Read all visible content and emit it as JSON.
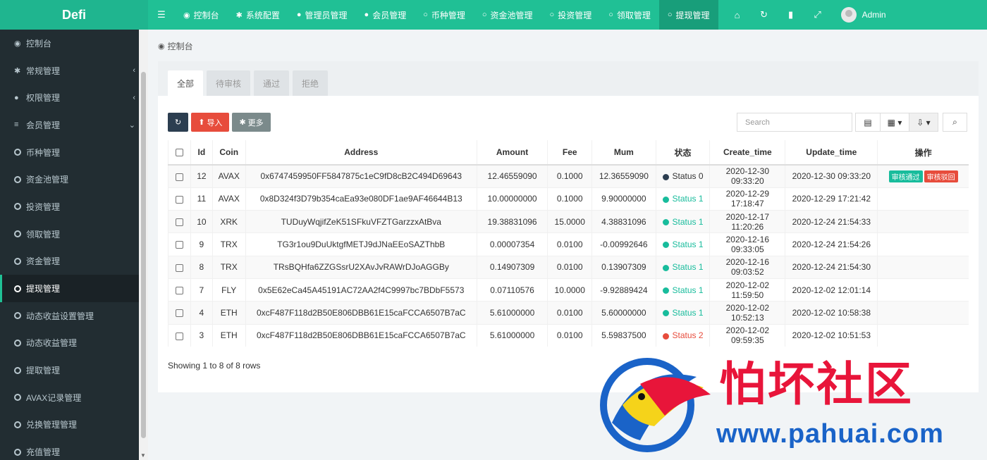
{
  "app": {
    "logo": "Defi"
  },
  "topnav": {
    "items": [
      {
        "label": "控制台",
        "icon": "dashboard-icon",
        "glyph": "◉"
      },
      {
        "label": "系统配置",
        "icon": "gear-icon",
        "glyph": "✱"
      },
      {
        "label": "管理员管理",
        "icon": "user-icon",
        "glyph": "●"
      },
      {
        "label": "会员管理",
        "icon": "user-icon",
        "glyph": "●"
      },
      {
        "label": "币种管理",
        "icon": "circle-icon",
        "glyph": "○"
      },
      {
        "label": "资金池管理",
        "icon": "circle-icon",
        "glyph": "○"
      },
      {
        "label": "投资管理",
        "icon": "circle-icon",
        "glyph": "○"
      },
      {
        "label": "领取管理",
        "icon": "circle-icon",
        "glyph": "○"
      },
      {
        "label": "提现管理",
        "icon": "circle-icon",
        "glyph": "○",
        "active": true
      }
    ],
    "user": "Admin"
  },
  "sidebar": {
    "items": [
      {
        "label": "控制台",
        "icon": "dashboard-icon",
        "glyph": "◉"
      },
      {
        "label": "常规管理",
        "icon": "cogs-icon",
        "glyph": "✱",
        "arrow": "‹"
      },
      {
        "label": "权限管理",
        "icon": "group-icon",
        "glyph": "●",
        "arrow": "‹"
      },
      {
        "label": "会员管理",
        "icon": "list-icon",
        "glyph": "≡",
        "arrow": "⌄"
      },
      {
        "label": "币种管理",
        "circle": true
      },
      {
        "label": "资金池管理",
        "circle": true
      },
      {
        "label": "投资管理",
        "circle": true
      },
      {
        "label": "领取管理",
        "circle": true
      },
      {
        "label": "资金管理",
        "circle": true
      },
      {
        "label": "提现管理",
        "circle": true,
        "active": true
      },
      {
        "label": "动态收益设置管理",
        "circle": true
      },
      {
        "label": "动态收益管理",
        "circle": true
      },
      {
        "label": "提取管理",
        "circle": true
      },
      {
        "label": "AVAX记录管理",
        "circle": true
      },
      {
        "label": "兑换管理管理",
        "circle": true
      },
      {
        "label": "充值管理",
        "circle": true
      }
    ]
  },
  "breadcrumb": {
    "label": "控制台"
  },
  "tabs": [
    "全部",
    "待审核",
    "通过",
    "拒绝"
  ],
  "toolbar": {
    "import_label": "导入",
    "more_label": "更多"
  },
  "search": {
    "placeholder": "Search"
  },
  "table": {
    "headers": [
      "Id",
      "Coin",
      "Address",
      "Amount",
      "Fee",
      "Mum",
      "状态",
      "Create_time",
      "Update_time",
      "操作"
    ],
    "rows": [
      {
        "id": "12",
        "coin": "AVAX",
        "address": "0x6747459950FF5847875c1eC9fD8cB2C494D69643",
        "amount": "12.46559090",
        "fee": "0.1000",
        "mum": "12.36559090",
        "status": "Status 0",
        "status_color": "#2c3e50",
        "create": "2020-12-30 09:33:20",
        "update": "2020-12-30 09:33:20",
        "actions": [
          "审核通过",
          "审核驳回"
        ]
      },
      {
        "id": "11",
        "coin": "AVAX",
        "address": "0x8D324f3D79b354caEa93e080DF1ae9AF46644B13",
        "amount": "10.00000000",
        "fee": "0.1000",
        "mum": "9.90000000",
        "status": "Status 1",
        "status_color": "#18bc9c",
        "create": "2020-12-29 17:18:47",
        "update": "2020-12-29 17:21:42",
        "actions": []
      },
      {
        "id": "10",
        "coin": "XRK",
        "address": "TUDuyWqjifZeK51SFkuVFZTGarzzxAtBva",
        "amount": "19.38831096",
        "fee": "15.0000",
        "mum": "4.38831096",
        "status": "Status 1",
        "status_color": "#18bc9c",
        "create": "2020-12-17 11:20:26",
        "update": "2020-12-24 21:54:33",
        "actions": []
      },
      {
        "id": "9",
        "coin": "TRX",
        "address": "TG3r1ou9DuUktgfMETJ9dJNaEEoSAZThbB",
        "amount": "0.00007354",
        "fee": "0.0100",
        "mum": "-0.00992646",
        "status": "Status 1",
        "status_color": "#18bc9c",
        "create": "2020-12-16 09:33:05",
        "update": "2020-12-24 21:54:26",
        "actions": []
      },
      {
        "id": "8",
        "coin": "TRX",
        "address": "TRsBQHfa6ZZGSsrU2XAvJvRAWrDJoAGGBy",
        "amount": "0.14907309",
        "fee": "0.0100",
        "mum": "0.13907309",
        "status": "Status 1",
        "status_color": "#18bc9c",
        "create": "2020-12-16 09:03:52",
        "update": "2020-12-24 21:54:30",
        "actions": []
      },
      {
        "id": "7",
        "coin": "FLY",
        "address": "0x5E62eCa45A45191AC72AA2f4C9997bc7BDbF5573",
        "amount": "0.07110576",
        "fee": "10.0000",
        "mum": "-9.92889424",
        "status": "Status 1",
        "status_color": "#18bc9c",
        "create": "2020-12-02 11:59:50",
        "update": "2020-12-02 12:01:14",
        "actions": []
      },
      {
        "id": "4",
        "coin": "ETH",
        "address": "0xcF487F118d2B50E806DBB61E15caFCCA6507B7aC",
        "amount": "5.61000000",
        "fee": "0.0100",
        "mum": "5.60000000",
        "status": "Status 1",
        "status_color": "#18bc9c",
        "create": "2020-12-02 10:52:13",
        "update": "2020-12-02 10:58:38",
        "actions": []
      },
      {
        "id": "3",
        "coin": "ETH",
        "address": "0xcF487F118d2B50E806DBB61E15caFCCA6507B7aC",
        "amount": "5.61000000",
        "fee": "0.0100",
        "mum": "5.59837500",
        "status": "Status 2",
        "status_color": "#e74c3c",
        "create": "2020-12-02 09:59:35",
        "update": "2020-12-02 10:51:53",
        "actions": []
      }
    ]
  },
  "pager": {
    "text": "Showing 1 to 8 of 8 rows"
  },
  "watermark": {
    "title": "怕坏社区",
    "url": "www.pahuai.com"
  }
}
